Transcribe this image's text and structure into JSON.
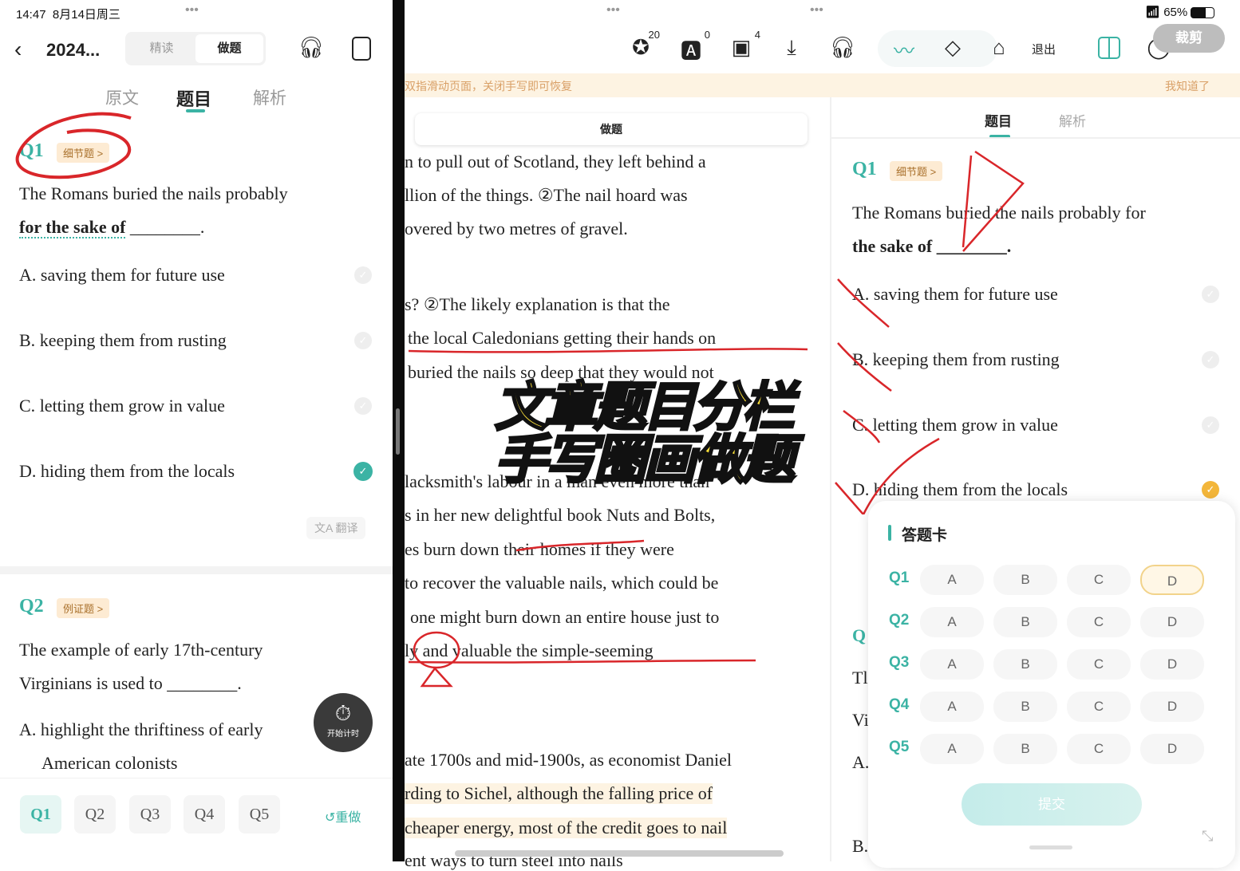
{
  "status": {
    "time": "14:47",
    "date": "8月14日周三",
    "battery": "65%"
  },
  "left": {
    "title": "2024...",
    "segment": [
      {
        "label": "精读",
        "active": false
      },
      {
        "label": "做题",
        "active": true
      }
    ],
    "tabs": [
      {
        "label": "原文"
      },
      {
        "label": "题目",
        "active": true
      },
      {
        "label": "解析"
      }
    ],
    "q1": {
      "no": "Q1",
      "tag": "细节题 >",
      "text1": "The Romans buried the nails probably",
      "text2_bold": "for the sake of",
      "text2_blank": " ________.",
      "options": [
        {
          "letter": "A.",
          "text": "saving them for future use"
        },
        {
          "letter": "B.",
          "text": "keeping them from rusting"
        },
        {
          "letter": "C.",
          "text": "letting them grow in value"
        },
        {
          "letter": "D.",
          "text": "hiding them from the locals",
          "checked": true
        }
      ]
    },
    "translate": "翻译",
    "q2": {
      "no": "Q2",
      "tag": "例证题 >",
      "text1": "The example of early 17th-century",
      "text2": "Virginians is used to ________.",
      "optA": "A. highlight the thriftiness of early",
      "optA2": "American colonists"
    },
    "timer": "开始计时",
    "bottom": {
      "chips": [
        "Q1",
        "Q2",
        "Q3",
        "Q4",
        "Q5"
      ],
      "active": "Q1",
      "redo": "重做"
    }
  },
  "toolbar": {
    "badge1": "20",
    "badge2": "0",
    "badge3": "4",
    "exit": "退出",
    "crop": "裁剪"
  },
  "banner": {
    "text": "双指滑动页面，关闭手写即可恢复",
    "dismiss": "我知道了"
  },
  "middle": {
    "card_title": "做题",
    "lines": [
      "n to pull out of Scotland, they left behind a",
      "llion of the things. ②The nail hoard was",
      "overed by two metres of gravel.",
      "s? ②The likely explanation is that the",
      "the local Caledonians getting their hands on",
      "buried the nails so deep that they would not",
      "lacksmith's labour in a man even more than",
      "s in her new delightful book Nuts and Bolts,",
      "es burn down their homes if they were",
      "to recover the valuable nails, which could be",
      "one might burn down an entire house just to",
      "ly and valuable the simple-seeming",
      "ate 1700s and mid-1900s, as economist Daniel",
      "rding to Sichel, although the falling price of",
      "cheaper energy, most of the credit goes to nail",
      "ent ways to turn steel into nails"
    ]
  },
  "overlay": {
    "line1": "文章题目分栏",
    "line2": "手写圈画做题"
  },
  "right": {
    "tabs": [
      {
        "label": "题目",
        "active": true
      },
      {
        "label": "解析"
      }
    ],
    "q1": {
      "no": "Q1",
      "tag": "细节题 >",
      "text1": "The Romans buried the nails probably for",
      "text2": "the sake of ________.",
      "options": [
        "A. saving them for future use",
        "B. keeping them from rusting",
        "C. letting them grow in value",
        "D. hiding them from the locals"
      ]
    },
    "answer_card": {
      "title": "答题卡",
      "rows": [
        {
          "q": "Q1",
          "selected": "D"
        },
        {
          "q": "Q2"
        },
        {
          "q": "Q3"
        },
        {
          "q": "Q4"
        },
        {
          "q": "Q5"
        }
      ],
      "options": [
        "A",
        "B",
        "C",
        "D"
      ],
      "submit": "提交"
    },
    "peek": [
      "Q",
      "Tl",
      "Vi",
      "A.",
      "B."
    ]
  },
  "colors": {
    "accent": "#3bb3a4",
    "banner": "#fdf3e2",
    "annotation": "#d9262a",
    "overlay": "#ffe33a"
  }
}
